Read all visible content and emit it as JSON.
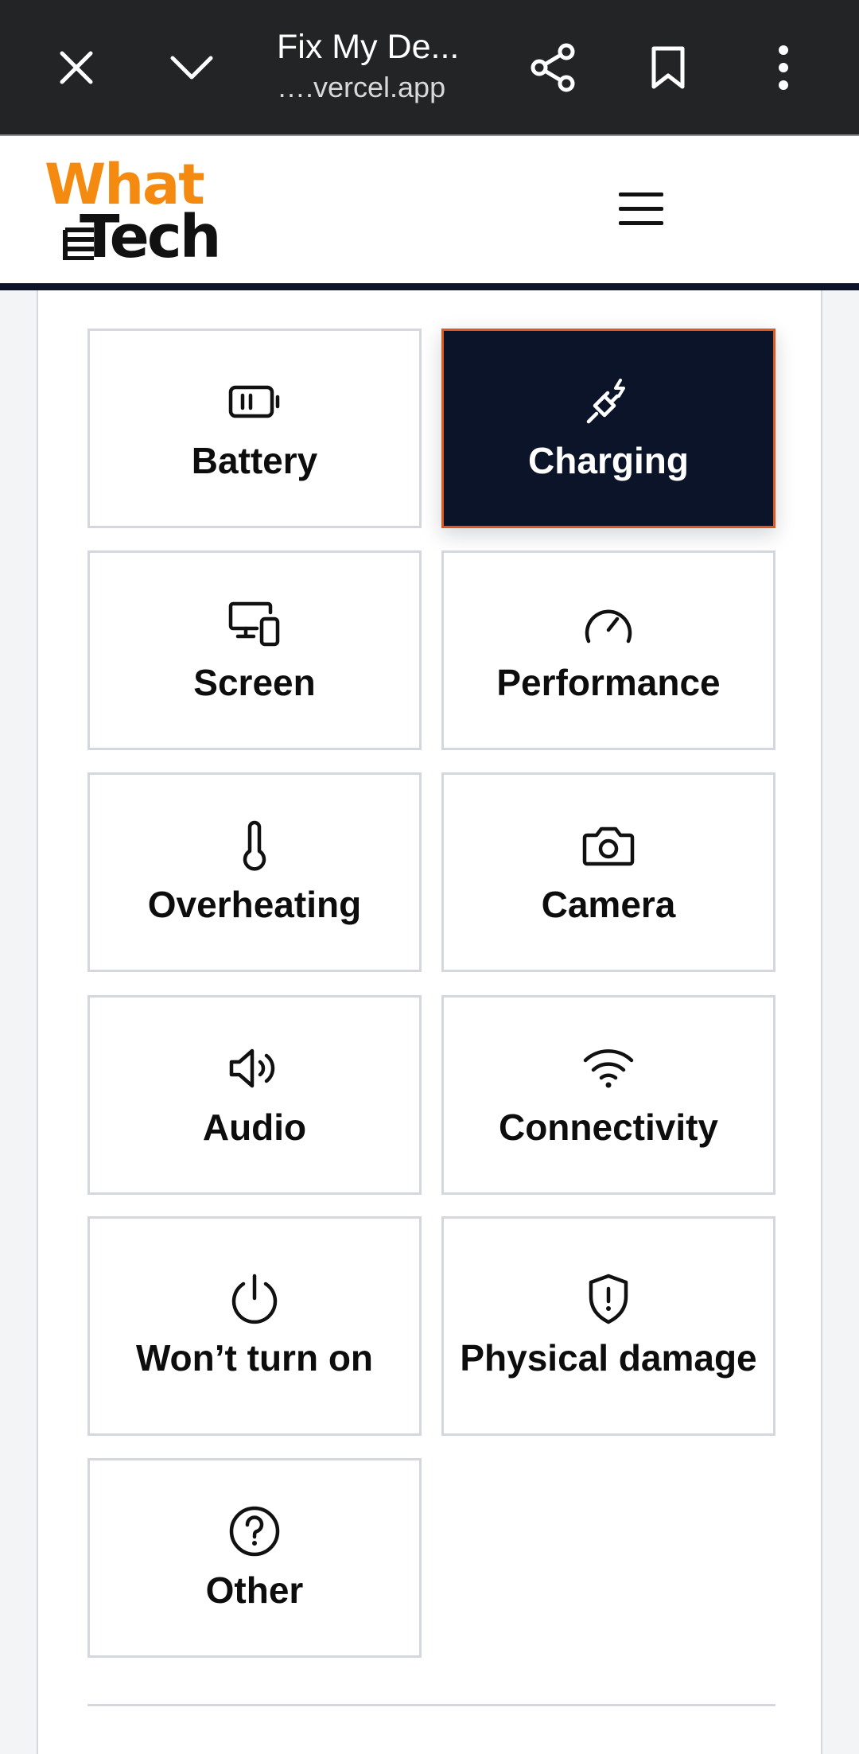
{
  "browser": {
    "title": "Fix My De...",
    "url": "….vercel.app",
    "icons": [
      "close-icon",
      "chevron-down-icon",
      "share-icon",
      "bookmark-icon",
      "more-vertical-icon"
    ]
  },
  "site": {
    "logo_top": "What",
    "logo_bottom": "Tech",
    "brand_color": "#f48a0f",
    "header_rule_color": "#0b1429"
  },
  "issues": [
    {
      "label": "Battery",
      "icon": "battery-icon",
      "selected": false
    },
    {
      "label": "Charging",
      "icon": "plug-icon",
      "selected": true
    },
    {
      "label": "Screen",
      "icon": "devices-icon",
      "selected": false
    },
    {
      "label": "Performance",
      "icon": "gauge-icon",
      "selected": false
    },
    {
      "label": "Overheating",
      "icon": "thermometer-icon",
      "selected": false
    },
    {
      "label": "Camera",
      "icon": "camera-icon",
      "selected": false
    },
    {
      "label": "Audio",
      "icon": "volume-icon",
      "selected": false
    },
    {
      "label": "Connectivity",
      "icon": "wifi-icon",
      "selected": false
    },
    {
      "label": "Won’t turn on",
      "icon": "power-icon",
      "selected": false
    },
    {
      "label": "Physical damage",
      "icon": "shield-alert-icon",
      "selected": false
    },
    {
      "label": "Other",
      "icon": "help-circle-icon",
      "selected": false
    }
  ],
  "colors": {
    "selected_bg": "#0b1429",
    "selected_border": "#e0571f",
    "tile_border": "#d4d7dd"
  }
}
